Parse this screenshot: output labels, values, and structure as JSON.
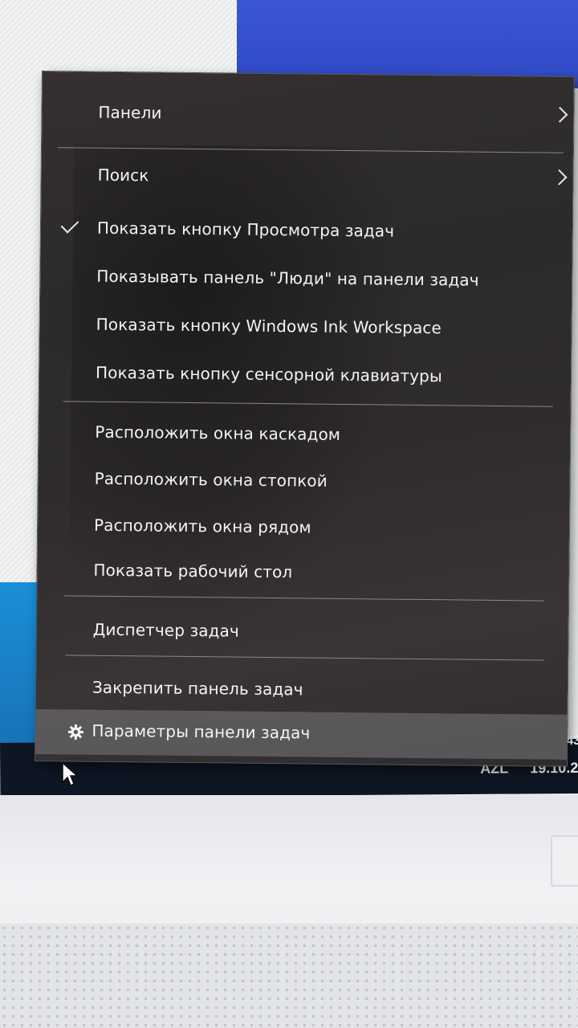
{
  "context_menu": {
    "items": [
      {
        "label": "Панели",
        "submenu": true
      },
      {
        "label": "Поиск",
        "submenu": true
      },
      {
        "label": "Показать кнопку Просмотра задач",
        "checked": true
      },
      {
        "label": "Показывать панель \"Люди\" на панели задач"
      },
      {
        "label": "Показать кнопку Windows Ink Workspace"
      },
      {
        "label": "Показать кнопку сенсорной клавиатуры"
      },
      {
        "label": "Расположить окна каскадом"
      },
      {
        "label": "Расположить окна стопкой"
      },
      {
        "label": "Расположить окна рядом"
      },
      {
        "label": "Показать рабочий стол"
      },
      {
        "label": "Диспетчер задач"
      },
      {
        "label": "Закрепить панель задач"
      },
      {
        "label": "Параметры панели задач",
        "icon": "gear-icon",
        "highlighted": true
      }
    ]
  },
  "taskbar": {
    "language": "AZL",
    "date": "19.10.2",
    "time_fragment": ":43",
    "tray_icons": [
      "chevron-up-icon",
      "onedrive-icon",
      "network-icon",
      "volume-icon"
    ]
  },
  "colors": {
    "menu_background": "#2e2b2d",
    "menu_text": "#f4f4f4",
    "taskbar": "#0d1622",
    "desktop_blue": "#3b56d6"
  }
}
